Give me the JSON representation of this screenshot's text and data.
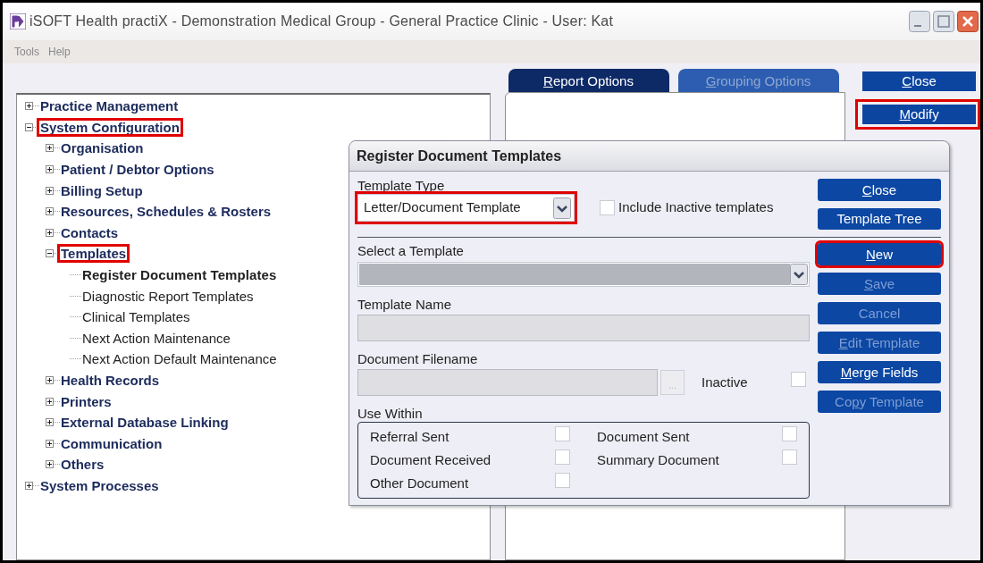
{
  "window": {
    "title": "iSOFT Health practiX - Demonstration Medical Group - General Practice Clinic - User: Kat"
  },
  "menu": [
    "Tools",
    "Help"
  ],
  "tree": [
    {
      "label": "Practice Management",
      "expanded": false,
      "selected": false,
      "highlighted": false
    },
    {
      "label": "System Configuration",
      "expanded": true,
      "selected": false,
      "highlighted": true,
      "children": [
        {
          "label": "Organisation",
          "expanded": false,
          "selected": false,
          "highlighted": false
        },
        {
          "label": "Patient / Debtor Options",
          "expanded": false,
          "selected": false,
          "highlighted": false
        },
        {
          "label": "Billing Setup",
          "expanded": false,
          "selected": false,
          "highlighted": false
        },
        {
          "label": "Resources, Schedules & Rosters",
          "expanded": false,
          "selected": false,
          "highlighted": false
        },
        {
          "label": "Contacts",
          "expanded": false,
          "selected": false,
          "highlighted": false
        },
        {
          "label": "Templates",
          "expanded": true,
          "selected": false,
          "highlighted": true,
          "children": [
            {
              "label": "Register Document Templates",
              "selected": true,
              "highlighted": false
            },
            {
              "label": "Diagnostic Report Templates",
              "selected": false,
              "highlighted": false
            },
            {
              "label": "Clinical Templates",
              "selected": false,
              "highlighted": false
            },
            {
              "label": "Next Action Maintenance",
              "selected": false,
              "highlighted": false
            },
            {
              "label": "Next Action Default Maintenance",
              "selected": false,
              "highlighted": false
            }
          ]
        },
        {
          "label": "Health Records",
          "expanded": false,
          "selected": false,
          "highlighted": false
        },
        {
          "label": "Printers",
          "expanded": false,
          "selected": false,
          "highlighted": false
        },
        {
          "label": "External Database Linking",
          "expanded": false,
          "selected": false,
          "highlighted": false
        },
        {
          "label": "Communication",
          "expanded": false,
          "selected": false,
          "highlighted": false
        },
        {
          "label": "Others",
          "expanded": false,
          "selected": false,
          "highlighted": false
        }
      ]
    },
    {
      "label": "System Processes",
      "expanded": false,
      "selected": false,
      "highlighted": false
    }
  ],
  "tabs": [
    {
      "label": {
        "key": "R",
        "post": "eport Options"
      },
      "selected": true
    },
    {
      "label": {
        "key": "G",
        "post": "rouping Options"
      },
      "selected": false
    }
  ],
  "side_buttons": [
    {
      "label": {
        "key": "C",
        "post": "lose"
      },
      "highlighted": false
    },
    {
      "label": {
        "key": "M",
        "post": "odify"
      },
      "highlighted": true
    }
  ],
  "dialog": {
    "title": "Register Document Templates",
    "template_type": {
      "label": "Template Type",
      "value": "Letter/Document Template",
      "highlighted": true
    },
    "include_inactive": {
      "label": "Include Inactive templates",
      "checked": false
    },
    "select_template": {
      "label": "Select a Template"
    },
    "template_name": {
      "label": "Template Name"
    },
    "document_filename": {
      "label": "Document Filename",
      "browse": "...",
      "inactive_label": "Inactive",
      "inactive_checked": false
    },
    "use_within": {
      "label": "Use Within",
      "options": [
        {
          "label": "Referral Sent",
          "checked": false
        },
        {
          "label": "Document Sent",
          "checked": false
        },
        {
          "label": "Document Received",
          "checked": false
        },
        {
          "label": "Summary Document",
          "checked": false
        },
        {
          "label": "Other Document",
          "checked": false
        }
      ]
    },
    "top_buttons": [
      {
        "label": {
          "key": "C",
          "post": "lose"
        },
        "disabled": false,
        "highlighted": false
      },
      {
        "label": {
          "pre": "Template Tree"
        },
        "disabled": false,
        "highlighted": false
      }
    ],
    "action_buttons": [
      {
        "label": {
          "key": "N",
          "post": "ew"
        },
        "disabled": false,
        "highlighted": true
      },
      {
        "label": {
          "key": "S",
          "post": "ave"
        },
        "disabled": true,
        "highlighted": false
      },
      {
        "label": {
          "pre": "Cancel"
        },
        "disabled": true,
        "highlighted": false
      },
      {
        "label": {
          "key": "E",
          "post": "dit Template"
        },
        "disabled": true,
        "highlighted": false
      },
      {
        "label": {
          "key": "M",
          "post": "erge Fields"
        },
        "disabled": false,
        "highlighted": false
      },
      {
        "label": {
          "pre": "Co",
          "key": "p",
          "post": "y Template"
        },
        "disabled": true,
        "highlighted": false
      }
    ]
  }
}
